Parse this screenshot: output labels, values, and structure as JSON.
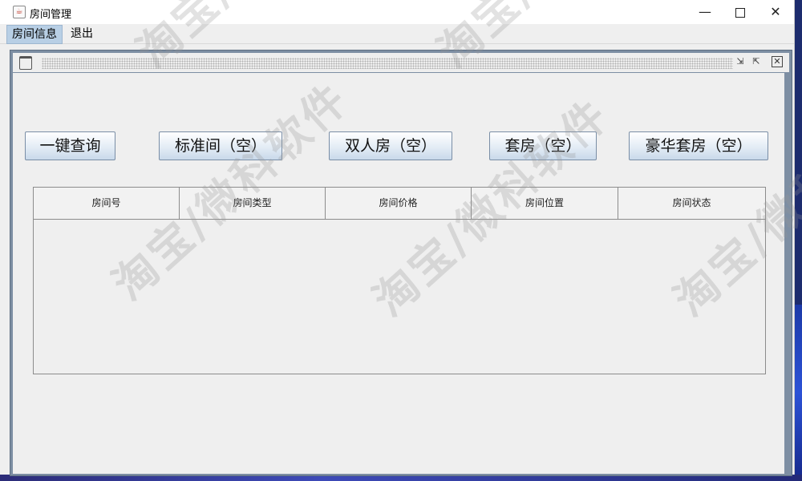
{
  "window": {
    "title": "房间管理",
    "controls": {
      "minimize": "—",
      "close": "✕"
    }
  },
  "menu": {
    "items": [
      {
        "label": "房间信息"
      },
      {
        "label": "退出"
      }
    ]
  },
  "toolbar": {
    "buttons": [
      {
        "label": "一键查询"
      },
      {
        "label": "标准间（空）"
      },
      {
        "label": "双人房（空）"
      },
      {
        "label": "套房（空）"
      },
      {
        "label": "豪华套房（空）"
      }
    ]
  },
  "table": {
    "columns": [
      "房间号",
      "房间类型",
      "房间价格",
      "房间位置",
      "房间状态"
    ],
    "rows": []
  },
  "watermark": "淘宝/微科软件",
  "colors": {
    "menu_selected": "#b8cfe5",
    "frame_border": "#7d8ea3",
    "desktop": "#1d2c6e"
  }
}
